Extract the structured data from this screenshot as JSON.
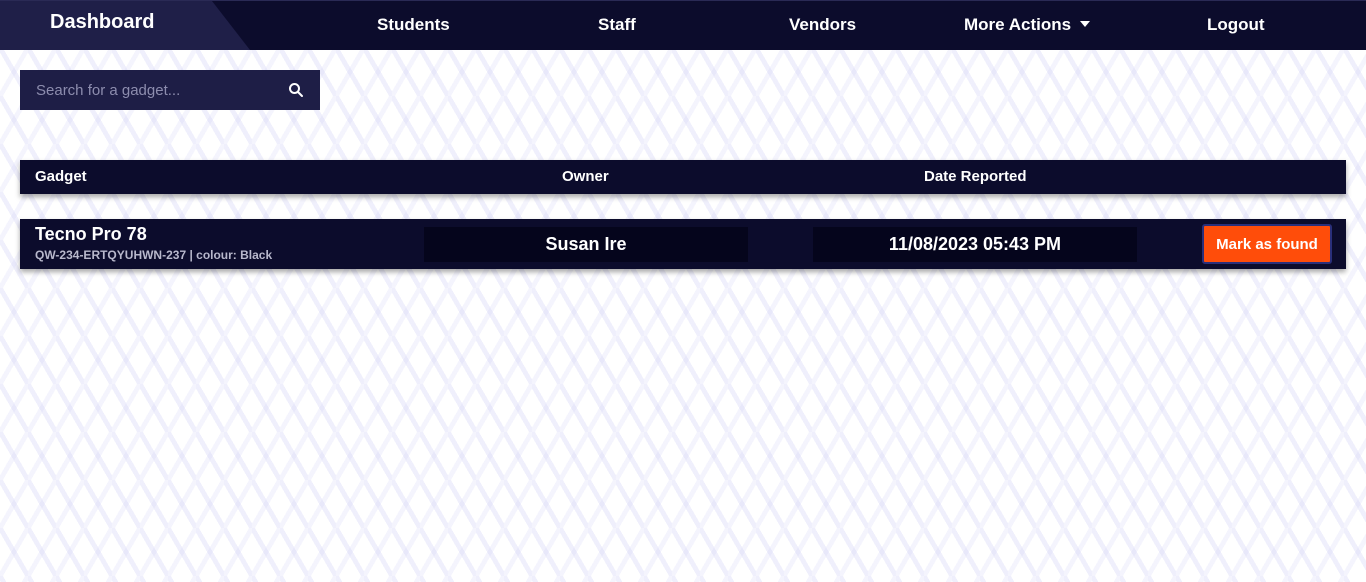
{
  "nav": {
    "brand": "Dashboard",
    "items": [
      {
        "label": "Students"
      },
      {
        "label": "Staff"
      },
      {
        "label": "Vendors"
      },
      {
        "label": "More Actions"
      },
      {
        "label": "Logout"
      }
    ]
  },
  "search": {
    "placeholder": "Search for a gadget...",
    "value": ""
  },
  "table": {
    "headers": [
      "Gadget",
      "Owner",
      "Date Reported"
    ],
    "rows": [
      {
        "gadget": "Tecno Pro 78",
        "meta": "QW-234-ERTQYUHWN-237 | colour: Black",
        "owner": "Susan Ire",
        "date": "11/08/2023 05:43 PM",
        "action": "Mark as found"
      }
    ]
  },
  "colors": {
    "nav_bg": "#0c0c2c",
    "brand_bg": "#1f1f48",
    "accent": "#ff4d0a"
  }
}
